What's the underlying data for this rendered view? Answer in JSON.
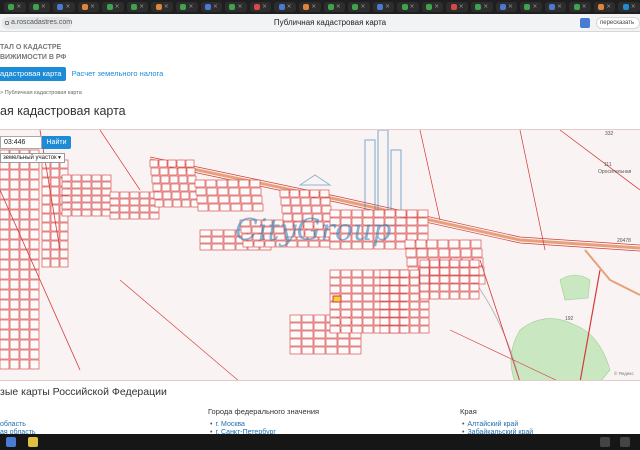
{
  "browser": {
    "tabs": [
      {
        "color": "#3fa34d"
      },
      {
        "color": "#3fa34d"
      },
      {
        "color": "#4a7bd4"
      },
      {
        "color": "#e0843a"
      },
      {
        "color": "#3fa34d"
      },
      {
        "color": "#3fa34d"
      },
      {
        "color": "#e0843a"
      },
      {
        "color": "#3fa34d"
      },
      {
        "color": "#4a7bd4"
      },
      {
        "color": "#3fa34d"
      },
      {
        "color": "#d94848"
      },
      {
        "color": "#4a7bd4"
      },
      {
        "color": "#e0843a"
      },
      {
        "color": "#3fa34d"
      },
      {
        "color": "#3fa34d"
      },
      {
        "color": "#4a7bd4"
      },
      {
        "color": "#3fa34d"
      },
      {
        "color": "#3fa34d"
      },
      {
        "color": "#d94848"
      },
      {
        "color": "#3fa34d"
      },
      {
        "color": "#4a7bd4"
      },
      {
        "color": "#3fa34d"
      },
      {
        "color": "#4a7bd4"
      },
      {
        "color": "#3fa34d"
      },
      {
        "color": "#e0843a"
      },
      {
        "color": "#1d8bd6"
      }
    ],
    "address": "a.roscadastres.com",
    "page_title": "Публичная кадастровая карта",
    "right_tab_label": "пересказать"
  },
  "site": {
    "title_line1": "ТАЛ О КАДАСТРЕ",
    "title_line2": "ВИЖИМОСТИ В РФ",
    "nav_active": "адастровая карта",
    "nav_link": "Расчет земельного налога",
    "breadcrumb": "> Публичная кадастровая карта",
    "heading": "ая кадастровая карта"
  },
  "map": {
    "search_value": "03:446",
    "search_button": "Найти",
    "object_type": "земельный участок",
    "watermark": "CityGroup",
    "road_label": "20478",
    "area_labels": [
      "Оросительная",
      "192",
      "332",
      "111"
    ],
    "attribution": "© Яндекс"
  },
  "below": {
    "heading": "зые карты Российской Федерации",
    "col1_items": [
      "область",
      "ая область"
    ],
    "col2_title": "Города федерального значения",
    "col2_items": [
      "г. Москва",
      "г. Санкт-Петербург"
    ],
    "col3_title": "Края",
    "col3_items": [
      "Алтайский край",
      "Забайкальский край"
    ]
  },
  "colors": {
    "accent": "#1d8bd6",
    "parcel_line": "#d43a3a",
    "road": "#e8a07a",
    "watermark": "#3b86b8"
  }
}
